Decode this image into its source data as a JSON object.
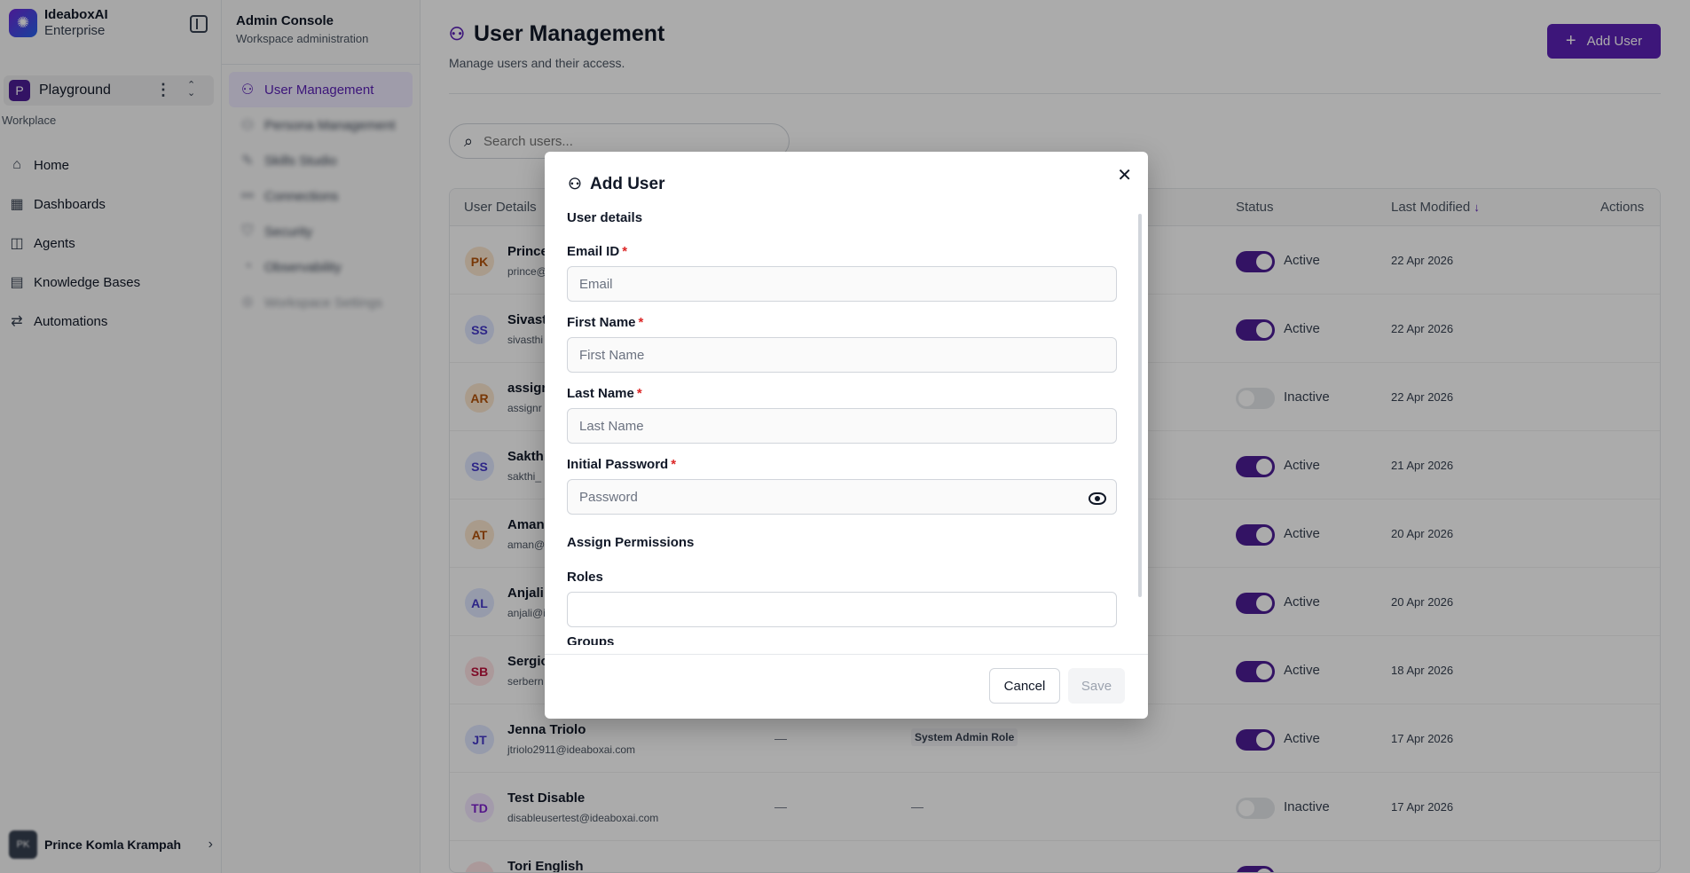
{
  "brand": {
    "name": "IdeaboxAI",
    "tier": "Enterprise"
  },
  "workspace": {
    "badge": "P",
    "name": "Playground"
  },
  "sidebar": {
    "section_label": "Workplace",
    "items": [
      {
        "label": "Home",
        "icon": "home-icon"
      },
      {
        "label": "Dashboards",
        "icon": "dashboard-icon"
      },
      {
        "label": "Agents",
        "icon": "agent-icon"
      },
      {
        "label": "Knowledge Bases",
        "icon": "knowledge-base-icon"
      },
      {
        "label": "Automations",
        "icon": "automation-icon"
      }
    ]
  },
  "current_user": {
    "initials": "PK",
    "name": "Prince Komla Krampah"
  },
  "console": {
    "title": "Admin Console",
    "subtitle": "Workspace administration",
    "items": [
      {
        "label": "User Management"
      },
      {
        "label": "Persona Management"
      },
      {
        "label": "Skills Studio"
      },
      {
        "label": "Connections"
      },
      {
        "label": "Security"
      },
      {
        "label": "Observability"
      },
      {
        "label": "Workspace Settings"
      }
    ]
  },
  "page": {
    "title": "User Management",
    "subtitle": "Manage users and their access.",
    "add_user_label": "Add User",
    "search_placeholder": "Search users..."
  },
  "table": {
    "headers": {
      "details": "User Details",
      "status": "Status",
      "last_modified": "Last Modified",
      "actions": "Actions"
    },
    "rows": [
      {
        "initials": "PK",
        "name": "Prince",
        "email": "prince@",
        "role": "",
        "status": "Active",
        "active": true,
        "date": "22 Apr 2026",
        "bg": "#fde7cf",
        "fg": "#b45309"
      },
      {
        "initials": "SS",
        "name": "Sivasth",
        "email": "sivasthi",
        "role": "",
        "status": "Active",
        "active": true,
        "date": "22 Apr 2026",
        "bg": "#e0e7ff",
        "fg": "#4338ca"
      },
      {
        "initials": "AR",
        "name": "assign",
        "email": "assignr",
        "role": "",
        "status": "Inactive",
        "active": false,
        "date": "22 Apr 2026",
        "bg": "#fde7cf",
        "fg": "#b45309"
      },
      {
        "initials": "SS",
        "name": "Sakthi",
        "email": "sakthi_",
        "role": "",
        "status": "Active",
        "active": true,
        "date": "21 Apr 2026",
        "bg": "#e0e7ff",
        "fg": "#4338ca"
      },
      {
        "initials": "AT",
        "name": "Aman",
        "email": "aman@",
        "role": "",
        "status": "Active",
        "active": true,
        "date": "20 Apr 2026",
        "bg": "#fde7cf",
        "fg": "#b45309"
      },
      {
        "initials": "AL",
        "name": "Anjali",
        "email": "anjali@i",
        "role": "",
        "status": "Active",
        "active": true,
        "date": "20 Apr 2026",
        "bg": "#e0e7ff",
        "fg": "#4338ca"
      },
      {
        "initials": "SB",
        "name": "Sergio",
        "email": "serbern",
        "role": "",
        "status": "Active",
        "active": true,
        "date": "18 Apr 2026",
        "bg": "#ffe4e6",
        "fg": "#be123c"
      },
      {
        "initials": "JT",
        "name": "Jenna Triolo",
        "email": "jtriolo2911@ideaboxai.com",
        "dash": "—",
        "role": "System Admin Role",
        "status": "Active",
        "active": true,
        "date": "17 Apr 2026",
        "bg": "#e0e7ff",
        "fg": "#4338ca"
      },
      {
        "initials": "TD",
        "name": "Test Disable",
        "email": "disableusertest@ideaboxai.com",
        "dash": "—",
        "role_dash": "—",
        "status": "Inactive",
        "active": false,
        "date": "17 Apr 2026",
        "bg": "#f3e8ff",
        "fg": "#7e22ce"
      },
      {
        "initials": "TE",
        "name": "Tori English",
        "email": "",
        "role": "",
        "status": "Active",
        "active": true,
        "date": "",
        "bg": "#ffe4e6",
        "fg": "#be123c"
      }
    ]
  },
  "modal": {
    "title": "Add User",
    "section_details": "User details",
    "email_label": "Email ID",
    "email_placeholder": "Email",
    "first_name_label": "First Name",
    "first_name_placeholder": "First Name",
    "last_name_label": "Last Name",
    "last_name_placeholder": "Last Name",
    "password_label": "Initial Password",
    "password_placeholder": "Password",
    "section_permissions": "Assign Permissions",
    "roles_label": "Roles",
    "groups_label": "Groups",
    "required_mark": "*",
    "cancel_label": "Cancel",
    "save_label": "Save"
  }
}
